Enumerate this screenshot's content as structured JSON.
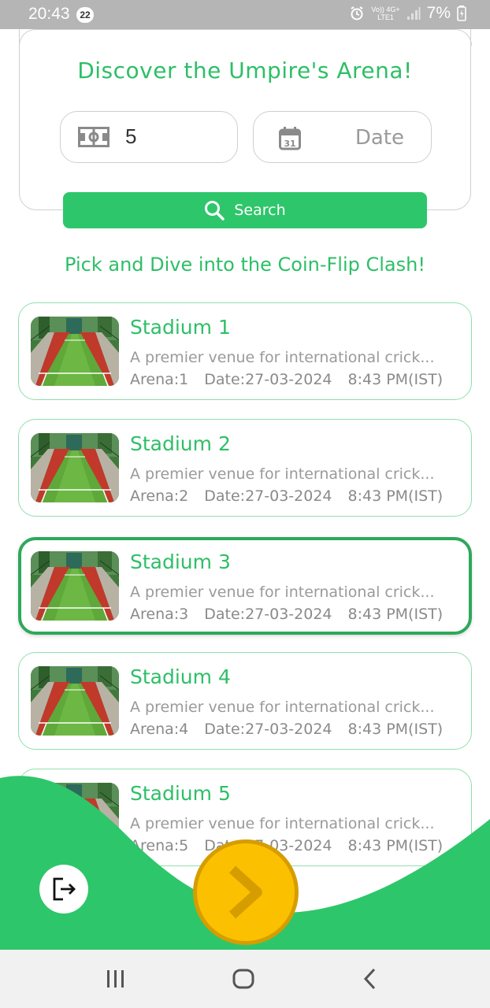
{
  "status_bar": {
    "time": "20:43",
    "notification_count": "22",
    "network_top": "Vo)) 4G+",
    "network_bottom": "LTE1",
    "battery": "7%"
  },
  "search_card": {
    "title": "Discover the Umpire's Arena!",
    "arena_value": "5",
    "date_placeholder": "Date",
    "search_label": "Search"
  },
  "subtitle": "Pick and Dive into the Coin-Flip Clash!",
  "stadiums": [
    {
      "name": "Stadium 1",
      "desc": "A premier venue for international crick...",
      "arena": "Arena:1",
      "date": "Date:27-03-2024",
      "time": "8:43 PM(IST)"
    },
    {
      "name": "Stadium 2",
      "desc": "A premier venue for international crick...",
      "arena": "Arena:2",
      "date": "Date:27-03-2024",
      "time": "8:43 PM(IST)"
    },
    {
      "name": "Stadium 3",
      "desc": "A premier venue for international crick...",
      "arena": "Arena:3",
      "date": "Date:27-03-2024",
      "time": "8:43 PM(IST)",
      "selected": true
    },
    {
      "name": "Stadium 4",
      "desc": "A premier venue for international crick...",
      "arena": "Arena:4",
      "date": "Date:27-03-2024",
      "time": "8:43 PM(IST)"
    },
    {
      "name": "Stadium 5",
      "desc": "A premier venue for international crick...",
      "arena": "Arena:5",
      "date": "Date:27-03-2024",
      "time": "8:43 PM(IST)"
    }
  ],
  "colors": {
    "brand_green": "#2ec66a",
    "title_green": "#2dbf67",
    "selected_border": "#2ea85a",
    "next_yellow": "#fbc000"
  },
  "icons": {
    "arena_field": "stadium-field-icon",
    "calendar": "calendar-icon",
    "search": "search-icon",
    "logout": "logout-icon",
    "next": "chevron-right-icon"
  }
}
